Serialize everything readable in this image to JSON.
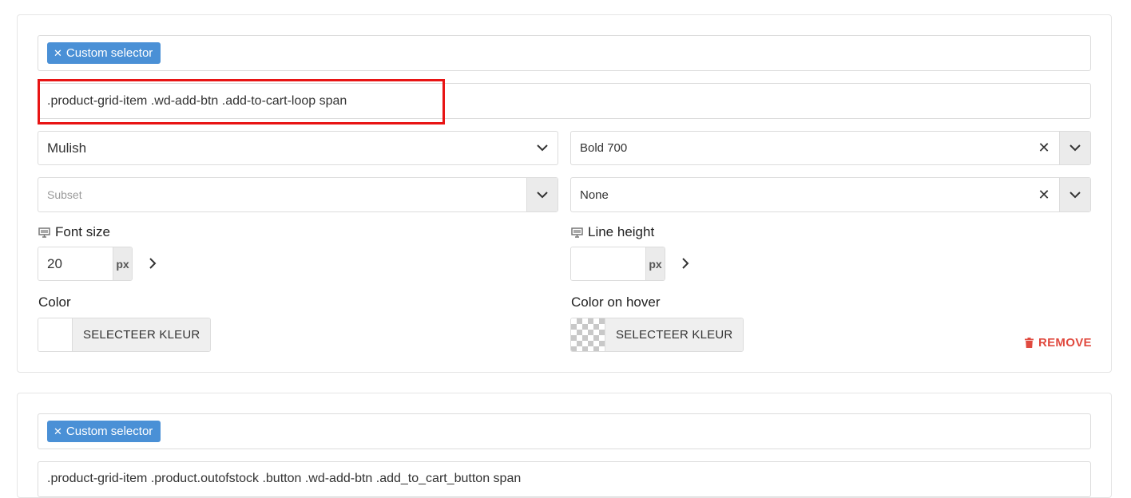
{
  "panel1": {
    "tag_label": "Custom selector",
    "tag_remove_icon": "close-icon",
    "selector_value": ".product-grid-item .wd-add-btn .add-to-cart-loop span",
    "font_family": "Mulish",
    "font_weight": "Bold 700",
    "subset_placeholder": "Subset",
    "transform": "None",
    "font_size_label": "Font size",
    "font_size_value": "20",
    "font_size_unit": "px",
    "line_height_label": "Line height",
    "line_height_value": "",
    "line_height_unit": "px",
    "color_label": "Color",
    "color_button": "SELECTEER KLEUR",
    "color_hover_label": "Color on hover",
    "color_hover_button": "SELECTEER KLEUR",
    "remove_label": "REMOVE"
  },
  "panel2": {
    "tag_label": "Custom selector",
    "selector_value": ".product-grid-item .product.outofstock .button .wd-add-btn .add_to_cart_button span"
  },
  "colors": {
    "tag_bg": "#4a90d6",
    "highlight": "#e81414",
    "remove": "#e04a3f"
  }
}
